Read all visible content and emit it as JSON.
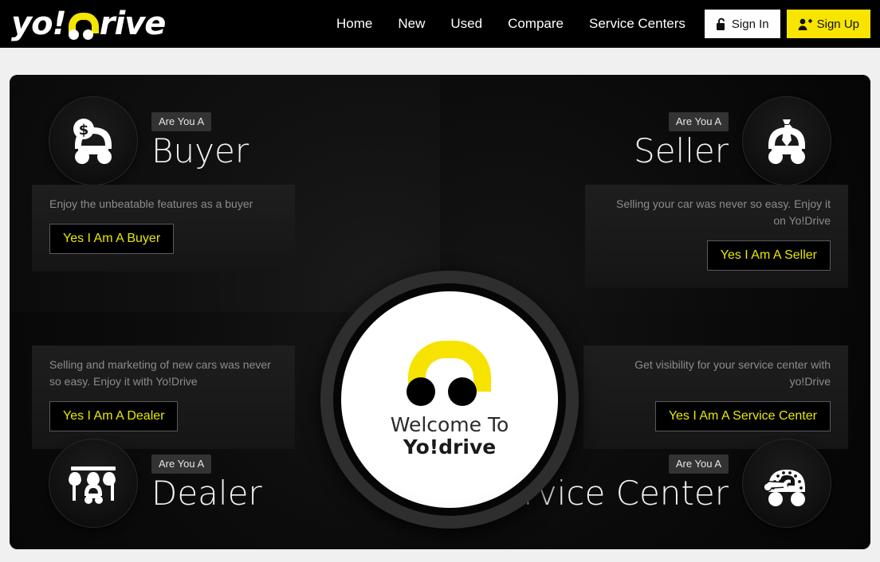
{
  "header": {
    "logo": {
      "pre": "yo!",
      "post": "rive",
      "alt": "yo!drive"
    },
    "nav": [
      {
        "label": "Home"
      },
      {
        "label": "New"
      },
      {
        "label": "Used"
      },
      {
        "label": "Compare"
      },
      {
        "label": "Service Centers"
      }
    ],
    "sign_in": "Sign In",
    "sign_up": "Sign Up"
  },
  "center": {
    "welcome": "Welcome To",
    "brand": "Yo!drive"
  },
  "quadrants": {
    "buyer": {
      "badge": "Are You A",
      "title": "Buyer",
      "description": "Enjoy the unbeatable features as a buyer",
      "cta": "Yes I Am A Buyer",
      "icon": "car-dollar-icon"
    },
    "seller": {
      "badge": "Are You A",
      "title": "Seller",
      "description": "Selling your car was never so easy. Enjoy it on Yo!Drive",
      "cta": "Yes I Am A Seller",
      "icon": "car-necktie-icon"
    },
    "dealer": {
      "badge": "Are You A",
      "title": "Dealer",
      "description": "Selling and marketing of new cars was never so easy. Enjoy it with Yo!Drive",
      "cta": "Yes I Am A Dealer",
      "icon": "car-shop-awning-icon"
    },
    "service_center": {
      "badge": "Are You A",
      "title": "Service Center",
      "description": "Get visibility for your service center with yo!Drive",
      "cta": "Yes I Am A Service Center",
      "icon": "car-wrench-icon"
    }
  },
  "colors": {
    "brand_yellow": "#f7e500",
    "cta_text": "#e8e800",
    "panel_bg": "#0c0c0c",
    "page_bg": "#f0f0f0"
  }
}
